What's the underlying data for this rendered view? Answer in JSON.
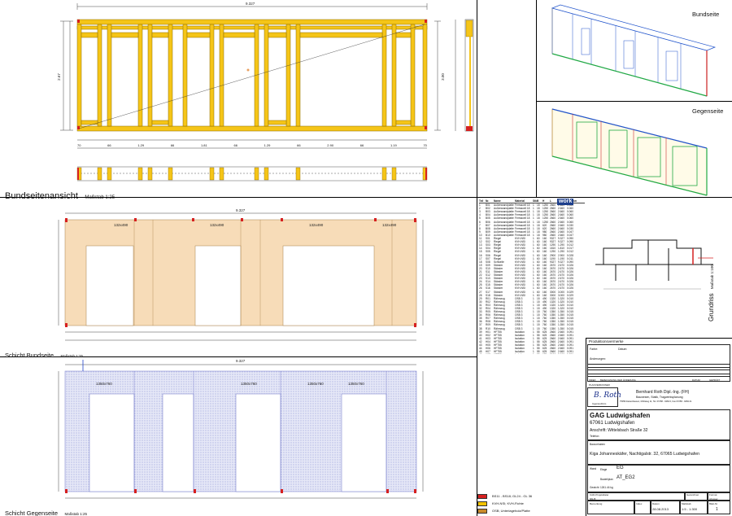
{
  "sections": {
    "bundseite_title": "Bundseitenansicht",
    "bundseite_scale": "Maßstab 1:25",
    "schicht_bund_title": "Schicht Bundseite",
    "schicht_bund_scale": "Maßstab 1:25",
    "schicht_gegen_title": "Schicht Gegenseite",
    "schicht_gegen_scale": "Maßstab 1:25",
    "view_bundseite": "Bundseite",
    "view_gegenseite": "Gegenseite",
    "grundriss": "Grundriss",
    "grundriss_scale": "Maßstab 1:100"
  },
  "dimensions": {
    "frame_chain": [
      "70",
      "66",
      "1.29",
      "66",
      "1.81",
      "66",
      "1.29",
      "66",
      "2.90",
      "66",
      "1.19",
      "70"
    ],
    "frame_total": "9.327",
    "height_left": "2.67",
    "height_right": "3.00",
    "opening_labels": [
      "132x490",
      "132x490",
      "132x490",
      "132x490"
    ],
    "gegen_labels": [
      "1350x760",
      "1350x760",
      "1350x760",
      "1350x760"
    ]
  },
  "part_list": {
    "headers": [
      "Teil",
      "Nr.",
      "Name",
      "Material",
      "Stk",
      "B",
      "H",
      "L",
      "Länge",
      "Volumen"
    ],
    "logo": "work",
    "rows": [
      [
        "1",
        "B01",
        "Außenwandplatte",
        "Fermacell 18",
        "1",
        "18",
        "1250",
        "2660",
        "2.660",
        "0.060"
      ],
      [
        "2",
        "B02",
        "Außenwandplatte",
        "Fermacell 18",
        "1",
        "18",
        "1250",
        "2660",
        "2.660",
        "0.060"
      ],
      [
        "3",
        "B03",
        "Außenwandplatte",
        "Fermacell 18",
        "1",
        "18",
        "1250",
        "2660",
        "2.660",
        "0.060"
      ],
      [
        "4",
        "B04",
        "Außenwandplatte",
        "Fermacell 18",
        "1",
        "18",
        "1250",
        "2660",
        "2.660",
        "0.060"
      ],
      [
        "5",
        "B05",
        "Außenwandplatte",
        "Fermacell 18",
        "1",
        "18",
        "1250",
        "2660",
        "2.660",
        "0.060"
      ],
      [
        "6",
        "B06",
        "Außenwandplatte",
        "Fermacell 18",
        "1",
        "18",
        "1250",
        "2660",
        "2.660",
        "0.060"
      ],
      [
        "7",
        "B07",
        "Außenwandplatte",
        "Fermacell 18",
        "1",
        "18",
        "620",
        "2660",
        "2.660",
        "0.030"
      ],
      [
        "8",
        "B08",
        "Außenwandplatte",
        "Fermacell 18",
        "1",
        "18",
        "620",
        "2660",
        "2.660",
        "0.030"
      ],
      [
        "9",
        "B09",
        "Außenwandplatte",
        "Fermacell 18",
        "1",
        "18",
        "980",
        "2660",
        "2.660",
        "0.047"
      ],
      [
        "10",
        "B10",
        "Außenwandplatte",
        "Fermacell 18",
        "1",
        "18",
        "980",
        "2660",
        "2.660",
        "0.047"
      ],
      [
        "11",
        "S01",
        "Riegel",
        "KVH-NSI",
        "1",
        "60",
        "160",
        "9327",
        "9.327",
        "0.090"
      ],
      [
        "12",
        "S02",
        "Riegel",
        "KVH-NSI",
        "1",
        "60",
        "160",
        "9327",
        "9.327",
        "0.090"
      ],
      [
        "13",
        "S03",
        "Riegel",
        "KVH-NSI",
        "1",
        "60",
        "160",
        "1290",
        "1.290",
        "0.012"
      ],
      [
        "14",
        "S04",
        "Riegel",
        "KVH-NSI",
        "1",
        "60",
        "160",
        "1810",
        "1.810",
        "0.017"
      ],
      [
        "15",
        "S05",
        "Riegel",
        "KVH-NSI",
        "1",
        "60",
        "160",
        "1290",
        "1.290",
        "0.012"
      ],
      [
        "16",
        "S06",
        "Riegel",
        "KVH-NSI",
        "1",
        "60",
        "160",
        "2900",
        "2.900",
        "0.028"
      ],
      [
        "17",
        "S07",
        "Riegel",
        "KVH-NSI",
        "1",
        "60",
        "160",
        "1190",
        "1.190",
        "0.011"
      ],
      [
        "18",
        "S08",
        "Schwelle",
        "KVH-NSI",
        "1",
        "60",
        "160",
        "9327",
        "9.327",
        "0.090"
      ],
      [
        "19",
        "S09",
        "Ständer",
        "KVH-NSI",
        "1",
        "60",
        "160",
        "2670",
        "2.670",
        "0.026"
      ],
      [
        "20",
        "S10",
        "Ständer",
        "KVH-NSI",
        "1",
        "60",
        "160",
        "2670",
        "2.670",
        "0.026"
      ],
      [
        "21",
        "S11",
        "Ständer",
        "KVH-NSI",
        "1",
        "60",
        "160",
        "2670",
        "2.670",
        "0.026"
      ],
      [
        "22",
        "S12",
        "Ständer",
        "KVH-NSI",
        "1",
        "60",
        "160",
        "2670",
        "2.670",
        "0.026"
      ],
      [
        "23",
        "S13",
        "Ständer",
        "KVH-NSI",
        "1",
        "60",
        "160",
        "2670",
        "2.670",
        "0.026"
      ],
      [
        "24",
        "S14",
        "Ständer",
        "KVH-NSI",
        "1",
        "60",
        "160",
        "2670",
        "2.670",
        "0.026"
      ],
      [
        "25",
        "S15",
        "Ständer",
        "KVH-NSI",
        "1",
        "60",
        "160",
        "2670",
        "2.670",
        "0.026"
      ],
      [
        "26",
        "S16",
        "Ständer",
        "KVH-NSI",
        "1",
        "60",
        "160",
        "2670",
        "2.670",
        "0.026"
      ],
      [
        "27",
        "S17",
        "Ständer",
        "KVH-NSI",
        "1",
        "60",
        "160",
        "3000",
        "3.000",
        "0.029"
      ],
      [
        "28",
        "S18",
        "Ständer",
        "KVH-NSI",
        "1",
        "60",
        "160",
        "3000",
        "3.000",
        "0.029"
      ],
      [
        "29",
        "R01",
        "Rähmzug",
        "OSB 3",
        "1",
        "15",
        "490",
        "1320",
        "1.320",
        "0.010"
      ],
      [
        "30",
        "R02",
        "Rähmzug",
        "OSB 3",
        "1",
        "15",
        "490",
        "1320",
        "1.320",
        "0.010"
      ],
      [
        "31",
        "R03",
        "Rähmzug",
        "OSB 3",
        "1",
        "15",
        "490",
        "1320",
        "1.320",
        "0.010"
      ],
      [
        "32",
        "R04",
        "Rähmzug",
        "OSB 3",
        "1",
        "15",
        "490",
        "1320",
        "1.320",
        "0.010"
      ],
      [
        "33",
        "R05",
        "Rähmzug",
        "OSB 3",
        "1",
        "15",
        "760",
        "1350",
        "1.350",
        "0.015"
      ],
      [
        "34",
        "R06",
        "Rähmzug",
        "OSB 3",
        "1",
        "15",
        "760",
        "1350",
        "1.350",
        "0.015"
      ],
      [
        "35",
        "R07",
        "Rähmzug",
        "OSB 3",
        "1",
        "15",
        "760",
        "1350",
        "1.350",
        "0.015"
      ],
      [
        "36",
        "R08",
        "Rähmzug",
        "OSB 3",
        "1",
        "15",
        "760",
        "1350",
        "1.350",
        "0.015"
      ],
      [
        "37",
        "R09",
        "Rähmzug",
        "OSB 3",
        "1",
        "15",
        "760",
        "1350",
        "1.350",
        "0.015"
      ],
      [
        "38",
        "R10",
        "Rähmzug",
        "OSB 3",
        "1",
        "15",
        "760",
        "1350",
        "1.350",
        "0.015"
      ],
      [
        "39",
        "H01",
        "HFT55",
        "Isolation",
        "1",
        "55",
        "625",
        "2660",
        "2.660",
        "0.091"
      ],
      [
        "40",
        "H02",
        "HFT55",
        "Isolation",
        "1",
        "55",
        "625",
        "2660",
        "2.660",
        "0.091"
      ],
      [
        "41",
        "H03",
        "HFT55",
        "Isolation",
        "1",
        "55",
        "625",
        "2660",
        "2.660",
        "0.091"
      ],
      [
        "42",
        "H04",
        "HFT55",
        "Isolation",
        "1",
        "55",
        "625",
        "2660",
        "2.660",
        "0.091"
      ],
      [
        "43",
        "H05",
        "HFT55",
        "Isolation",
        "1",
        "55",
        "625",
        "2660",
        "2.660",
        "0.091"
      ],
      [
        "44",
        "H06",
        "HFT55",
        "Isolation",
        "1",
        "55",
        "625",
        "2660",
        "2.660",
        "0.091"
      ],
      [
        "45",
        "H07",
        "HFT55",
        "Isolation",
        "1",
        "55",
        "625",
        "2660",
        "2.660",
        "0.091"
      ],
      [
        "46",
        "H08",
        "HFT55",
        "Isolation",
        "1",
        "55",
        "625",
        "2660",
        "2.660",
        "0.091"
      ]
    ]
  },
  "legend": {
    "items": [
      {
        "color": "#d62020",
        "label": "BS11 - BS18; GL24 - GL 36"
      },
      {
        "color": "#f2c200",
        "label": "KVH-NSI; KVH-Fichte"
      },
      {
        "color": "#c98a2a",
        "label": "OSB; Unterlageholz/Platte"
      }
    ]
  },
  "title_block": {
    "remarks_label": "Produktionsvermerke",
    "remarks_row1_a": "Farbe:",
    "remarks_row1_b": "Datum:",
    "remarks_row2": "Änderungen:",
    "change_header": [
      "INDEX",
      "BEZEICHNUNG DER ÄNDERUNG",
      "DATUM",
      "GEPRÜFT"
    ],
    "planverfasser": "PLANVERFASSER",
    "office_name": "Bernhard Roth  Dipl.-Ing. (FH)",
    "office_line2": "Bauwesen, Statik, Tragwerksplanung",
    "office_line3": "75059 Zaisenhausen, Mühlweg 11, Tel. 07258 - 9284 0, Fax 07258 - 9284 21",
    "signature": "B. Roth",
    "signature_sub": "Ingenieurbüro",
    "client": "GAG Ludwigshafen",
    "client_city": "67061   Ludwigshafen",
    "client_address": "Anschrift: Wittelsbach Straße 32",
    "client_phone": "Telefon:",
    "project_label": "Bauvorhaben",
    "project": "Kiga Johanneskäfer, Nachtigalstr. 32, 67065 Ludwigshafen",
    "wand_label": "Wand",
    "etage_label": "Etage",
    "etage": "EG",
    "bauteil_label": "Bauteilplan",
    "bauteil": "AT_EG2",
    "gewicht_label": "Gewicht",
    "gewicht": "1261.44 kg",
    "projekt_nr_label": "CAD-Projektdatei",
    "projekt_nr": "NN-B",
    "gezeichnet_label": "Gezeichnet",
    "gezeichnet": "Format",
    "format_label": "A3-quer",
    "bemerkung_label": "Bemerkung",
    "index_label": "Index",
    "datum_label": "Datum",
    "datum": "28.08.2013",
    "massstab_label": "Maßstab",
    "massstab": "1:5 - 1:300",
    "blatt_label": "Blatt-Nr.",
    "blatt": "1"
  }
}
